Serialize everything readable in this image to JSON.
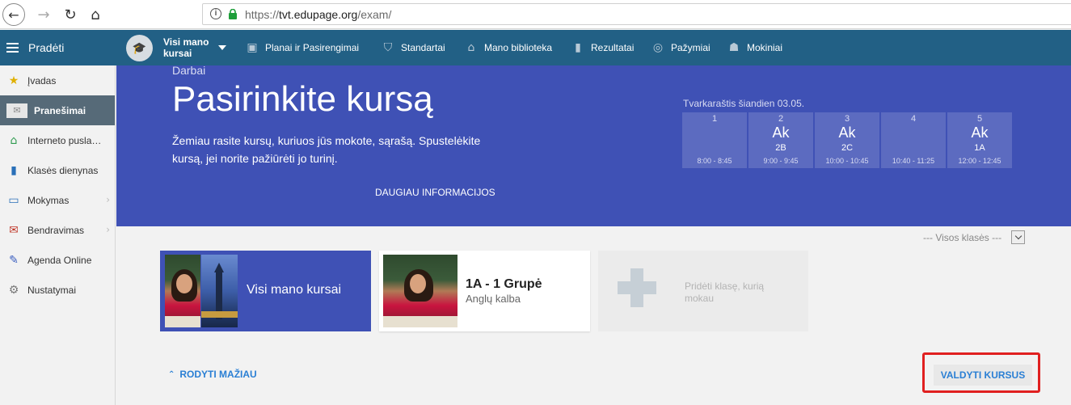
{
  "browser": {
    "url_scheme": "https://",
    "url_host": "tvt.edupage.org",
    "url_path": "/exam/"
  },
  "topbar": {
    "menu_label": "Pradėti",
    "course_selector": "Visi mano kursai",
    "nav": [
      {
        "label": "Planai ir Pasirengimai",
        "icon": "briefcase-icon"
      },
      {
        "label": "Standartai",
        "icon": "shield-icon"
      },
      {
        "label": "Mano biblioteka",
        "icon": "library-icon"
      },
      {
        "label": "Rezultatai",
        "icon": "bar-chart-icon"
      },
      {
        "label": "Pažymiai",
        "icon": "grades-icon"
      },
      {
        "label": "Mokiniai",
        "icon": "students-icon"
      }
    ]
  },
  "sidebar": {
    "items": [
      {
        "label": "Įvadas",
        "icon": "star-icon"
      },
      {
        "label": "Pranešimai",
        "icon": "envelope-icon",
        "active": true
      },
      {
        "label": "Interneto puslapis",
        "icon": "home-icon"
      },
      {
        "label": "Klasės dienynas",
        "icon": "book-icon"
      },
      {
        "label": "Mokymas",
        "icon": "open-book-icon"
      },
      {
        "label": "Bendravimas",
        "icon": "chat-icon"
      },
      {
        "label": "Agenda Online",
        "icon": "pen-icon"
      },
      {
        "label": "Nustatymai",
        "icon": "gear-icon"
      }
    ]
  },
  "hero": {
    "crumb": "Darbai",
    "title": "Pasirinkite kursą",
    "description": "Žemiau rasite kursų, kuriuos jūs mokote, sąrašą. Spustelėkite kursą, jei norite pažiūrėti jo turinį.",
    "more_link": "DAUGIAU INFORMACIJOS",
    "timetable_caption": "Tvarkaraštis šiandien 03.05.",
    "timetable": [
      {
        "num": "1",
        "subject": "",
        "cls": "",
        "time": "8:00 - 8:45"
      },
      {
        "num": "2",
        "subject": "Ak",
        "cls": "2B",
        "time": "9:00 - 9:45"
      },
      {
        "num": "3",
        "subject": "Ak",
        "cls": "2C",
        "time": "10:00 - 10:45"
      },
      {
        "num": "4",
        "subject": "",
        "cls": "",
        "time": "10:40 - 11:25"
      },
      {
        "num": "5",
        "subject": "Ak",
        "cls": "1A",
        "time": "12:00 - 12:45"
      }
    ]
  },
  "filter": {
    "value": "--- Visos klasės ---"
  },
  "cards": {
    "all": {
      "title": "Visi mano kursai"
    },
    "class": {
      "title": "1A - 1 Grupė",
      "subtitle": "Anglų kalba"
    },
    "add": {
      "label": "Pridėti klasę, kurią mokau"
    }
  },
  "actions": {
    "show_less": "RODYTI MAŽIAU",
    "manage": "VALDYTI KURSUS",
    "highlight_color": "#e02020"
  },
  "colors": {
    "topbar": "#226085",
    "hero": "#3f51b5",
    "link": "#2a7fd4"
  }
}
